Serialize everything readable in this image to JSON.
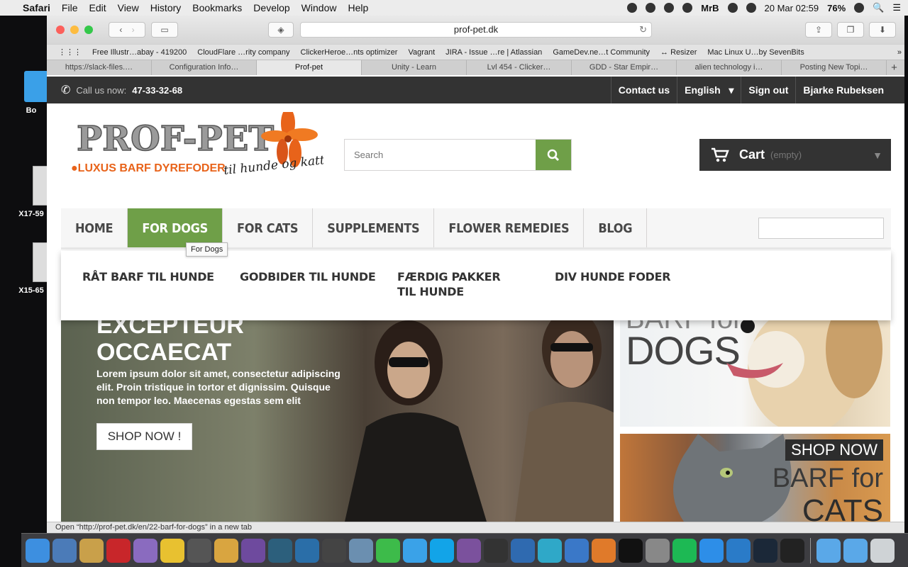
{
  "menubar": {
    "app": "Safari",
    "items": [
      "File",
      "Edit",
      "View",
      "History",
      "Bookmarks",
      "Develop",
      "Window",
      "Help"
    ],
    "user": "MrB",
    "datetime": "20 Mar  02:59",
    "battery": "76%"
  },
  "desktop": {
    "icons": [
      {
        "label": "Bo"
      },
      {
        "label": "X17-59"
      },
      {
        "label": "X15-65"
      }
    ]
  },
  "browser": {
    "url": "prof-pet.dk",
    "bookmarks": [
      "Free Illustr…abay - 419200",
      "CloudFlare …rity company",
      "ClickerHeroe…nts optimizer",
      "Vagrant",
      "JIRA - Issue …re | Atlassian",
      "GameDev.ne…t Community",
      "↔ Resizer",
      "Mac Linux U…by SevenBits"
    ],
    "tabs": [
      {
        "label": "https://slack-files.…",
        "active": false
      },
      {
        "label": "Configuration Info…",
        "active": false
      },
      {
        "label": "Prof-pet",
        "active": true
      },
      {
        "label": "Unity - Learn",
        "active": false
      },
      {
        "label": "Lvl 454 - Clicker…",
        "active": false
      },
      {
        "label": "GDD - Star Empir…",
        "active": false
      },
      {
        "label": "alien technology i…",
        "active": false
      },
      {
        "label": "Posting New Topi…",
        "active": false
      }
    ],
    "status": "Open “http://prof-pet.dk/en/22-barf-for-dogs” in a new tab"
  },
  "site": {
    "topbar": {
      "call_label": "Call us now:",
      "phone": "47-33-32-68",
      "links": [
        "Contact us",
        "English",
        "Sign out",
        "Bjarke Rubeksen"
      ]
    },
    "logo": {
      "name": "PROF-PET",
      "tagline": "●LUXUS BARF DYREFODER",
      "script": "til hunde og katte"
    },
    "search": {
      "placeholder": "Search"
    },
    "cart": {
      "label": "Cart",
      "status": "(empty)"
    },
    "nav": {
      "items": [
        "HOME",
        "FOR DOGS",
        "FOR CATS",
        "SUPPLEMENTS",
        "FLOWER REMEDIES",
        "BLOG"
      ],
      "active": "FOR DOGS",
      "tooltip": "For Dogs"
    },
    "submenu": [
      "RÅT BARF TIL HUNDE",
      "GODBIDER TIL HUNDE",
      "FÆRDIG PAKKER TIL HUNDE",
      "DIV HUNDE FODER"
    ],
    "hero": {
      "title_line1": "EXCEPTEUR",
      "title_line2": "OCCAECAT",
      "description": "Lorem ipsum dolor sit amet, consectetur adipiscing elit. Proin tristique in tortor et dignissim. Quisque non tempor leo. Maecenas egestas sem elit",
      "button": "SHOP NOW !"
    },
    "banners": {
      "dogs": {
        "line1": "BARF for",
        "line2": "DOGS"
      },
      "cats": {
        "shop": "SHOP NOW",
        "line1": "BARF for",
        "line2": "CATS"
      }
    }
  },
  "colors": {
    "accent": "#6f9f48",
    "dark": "#333333"
  }
}
